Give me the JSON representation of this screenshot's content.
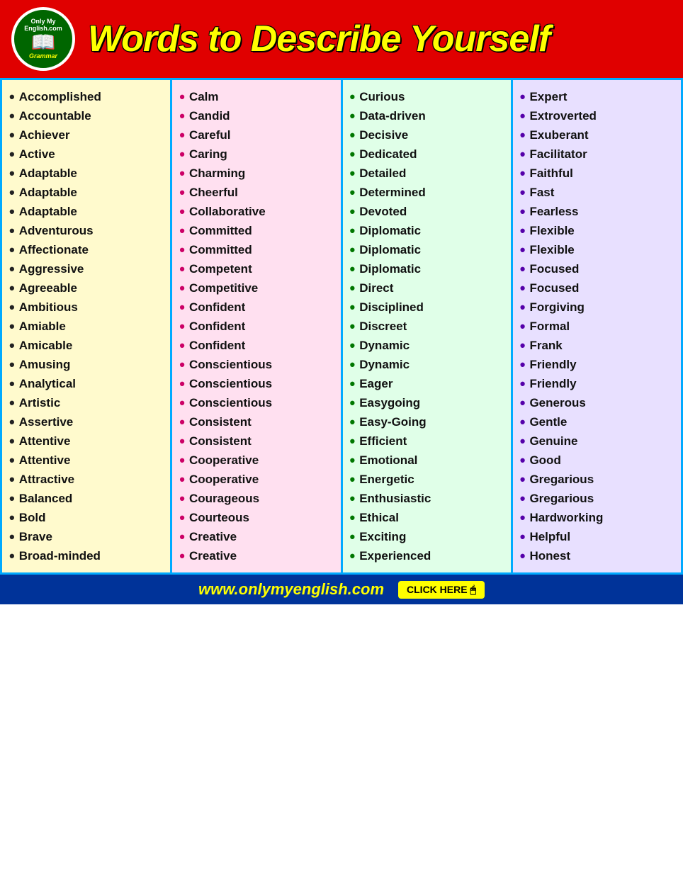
{
  "header": {
    "logo_top": "Only My English.com",
    "logo_bottom": "Grammar",
    "title": "Words to Describe Yourself"
  },
  "columns": [
    {
      "id": "col1",
      "color": "yellow",
      "words": [
        "Accomplished",
        "Accountable",
        "Achiever",
        "Active",
        "Adaptable",
        "Adaptable",
        "Adaptable",
        "Adventurous",
        "Affectionate",
        "Aggressive",
        "Agreeable",
        "Ambitious",
        "Amiable",
        "Amicable",
        "Amusing",
        "Analytical",
        "Artistic",
        "Assertive",
        "Attentive",
        "Attentive",
        "Attractive",
        "Balanced",
        "Bold",
        "Brave",
        "Broad-minded"
      ]
    },
    {
      "id": "col2",
      "color": "pink",
      "words": [
        "Calm",
        "Candid",
        "Careful",
        "Caring",
        "Charming",
        "Cheerful",
        "Collaborative",
        "Committed",
        "Committed",
        "Competent",
        "Competitive",
        "Confident",
        "Confident",
        "Confident",
        "Conscientious",
        "Conscientious",
        "Conscientious",
        "Consistent",
        "Consistent",
        "Cooperative",
        "Cooperative",
        "Courageous",
        "Courteous",
        "Creative",
        "Creative"
      ]
    },
    {
      "id": "col3",
      "color": "green",
      "words": [
        "Curious",
        "Data-driven",
        "Decisive",
        "Dedicated",
        "Detailed",
        "Determined",
        "Devoted",
        "Diplomatic",
        "Diplomatic",
        "Diplomatic",
        "Direct",
        "Disciplined",
        "Discreet",
        "Dynamic",
        "Dynamic",
        "Eager",
        "Easygoing",
        "Easy-Going",
        "Efficient",
        "Emotional",
        "Energetic",
        "Enthusiastic",
        "Ethical",
        "Exciting",
        "Experienced"
      ]
    },
    {
      "id": "col4",
      "color": "purple",
      "words": [
        "Expert",
        "Extroverted",
        "Exuberant",
        "Facilitator",
        "Faithful",
        "Fast",
        "Fearless",
        "Flexible",
        "Flexible",
        "Focused",
        "Focused",
        "Forgiving",
        "Formal",
        "Frank",
        "Friendly",
        "Friendly",
        "Generous",
        "Gentle",
        "Genuine",
        "Good",
        "Gregarious",
        "Gregarious",
        "Hardworking",
        "Helpful",
        "Honest"
      ]
    }
  ],
  "footer": {
    "url": "www.onlymyenglish.com",
    "cta": "CLICK HERE"
  }
}
